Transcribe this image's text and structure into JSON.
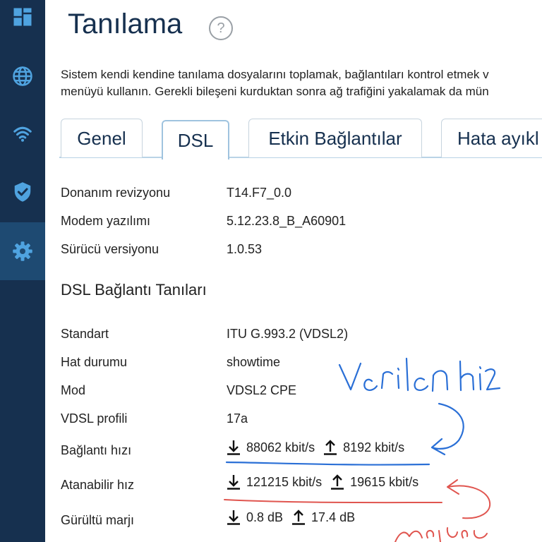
{
  "sidebar": {
    "items": [
      {
        "icon": "dashboard-icon"
      },
      {
        "icon": "globe-icon"
      },
      {
        "icon": "wifi-icon"
      },
      {
        "icon": "shield-check-icon"
      },
      {
        "icon": "gear-icon"
      }
    ],
    "active_index": 4
  },
  "header": {
    "title": "Tanılama",
    "help_symbol": "?"
  },
  "description": {
    "line1": "Sistem kendi kendine tanılama dosyalarını toplamak, bağlantıları kontrol etmek v",
    "line2": "menüyü kullanın. Gerekli bileşeni kurduktan sonra ağ trafiğini yakalamak da mün"
  },
  "tabs": [
    {
      "label": "Genel"
    },
    {
      "label": "DSL"
    },
    {
      "label": "Etkin Bağlantılar"
    },
    {
      "label": "Hata ayıkl"
    }
  ],
  "info": {
    "hw_label": "Donanım revizyonu",
    "hw_value": "T14.F7_0.0",
    "fw_label": "Modem yazılımı",
    "fw_value": "5.12.23.8_B_A60901",
    "drv_label": "Sürücü versiyonu",
    "drv_value": "1.0.53"
  },
  "dsl": {
    "section_title": "DSL Bağlantı Tanıları",
    "standard_label": "Standart",
    "standard_value": "ITU G.993.2 (VDSL2)",
    "line_label": "Hat durumu",
    "line_value": "showtime",
    "mode_label": "Mod",
    "mode_value": "VDSL2 CPE",
    "profile_label": "VDSL profili",
    "profile_value": "17a",
    "conn_label": "Bağlantı hızı",
    "conn_down": "88062 kbit/s",
    "conn_up": "8192 kbit/s",
    "att_label": "Atanabilir hız",
    "att_down": "121215 kbit/s",
    "att_up": "19615 kbit/s",
    "noise_label": "Gürültü marjı",
    "noise_down": "0.8 dB",
    "noise_up": "17.4 dB"
  },
  "colors": {
    "sidebar_bg": "#16304f",
    "sidebar_active": "#1e4a72",
    "icon": "#4fa3e0",
    "title": "#16304f",
    "annotation_blue": "#2a6fd6",
    "annotation_red": "#e0554f"
  }
}
